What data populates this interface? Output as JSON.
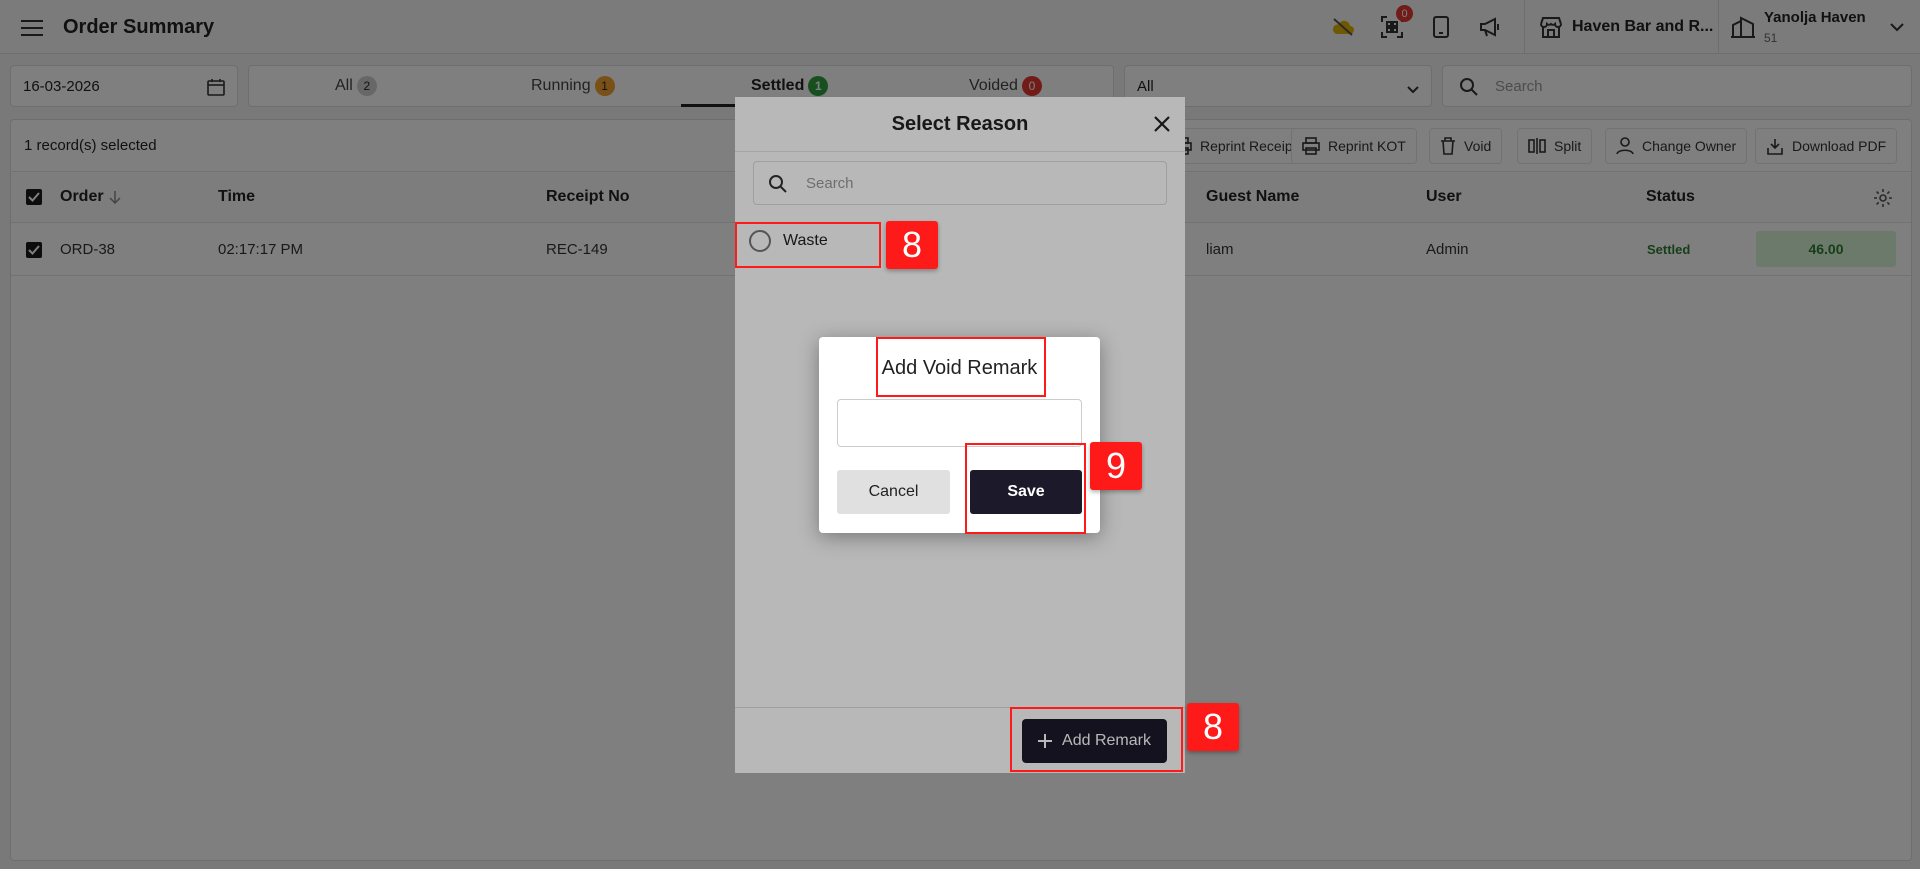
{
  "header": {
    "title": "Order Summary",
    "notification_count": "0",
    "store_name": "Haven Bar and R...",
    "user_name": "Yanolja Haven",
    "user_sub": "51"
  },
  "filters": {
    "date": "16-03-2026",
    "tabs": [
      {
        "label": "All",
        "count": "2",
        "color": "#cfcfcf"
      },
      {
        "label": "Running",
        "count": "1",
        "color": "#f0a030"
      },
      {
        "label": "Settled",
        "count": "1",
        "color": "#2e9e3e"
      },
      {
        "label": "Voided",
        "count": "0",
        "color": "#e53935"
      }
    ],
    "select_value": "All",
    "search_placeholder": "Search"
  },
  "table": {
    "selection_text": "1 record(s) selected",
    "actions": [
      "Reprint Receipt",
      "Reprint KOT",
      "Void",
      "Split",
      "Change Owner",
      "Download PDF"
    ],
    "columns": [
      "Order",
      "Time",
      "Receipt No",
      "Guest Name",
      "User",
      "Status"
    ],
    "rows": [
      {
        "order": "ORD-38",
        "time": "02:17:17 PM",
        "receipt": "REC-149",
        "guest": "liam",
        "user": "Admin",
        "status": "Settled",
        "amount": "46.00"
      }
    ]
  },
  "reason_modal": {
    "title": "Select Reason",
    "search_placeholder": "Search",
    "reasons": [
      "Waste"
    ],
    "add_remark_label": "Add Remark"
  },
  "void_dialog": {
    "title": "Add Void Remark",
    "input_value": "",
    "cancel_label": "Cancel",
    "save_label": "Save"
  },
  "annotations": {
    "step_waste": "8",
    "step_add_remark": "8",
    "step_save": "9",
    "highlight_color": "#ff1a1a"
  }
}
